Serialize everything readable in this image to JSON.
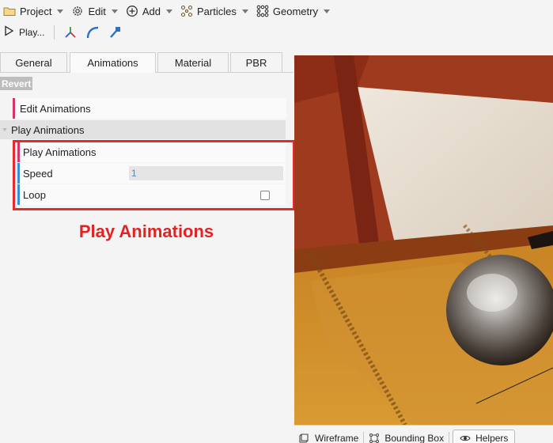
{
  "menubar": {
    "project": "Project",
    "edit": "Edit",
    "add": "Add",
    "particles": "Particles",
    "geometry": "Geometry"
  },
  "toolbar": {
    "play": "Play..."
  },
  "tabs": [
    "General",
    "Animations",
    "Material",
    "PBR"
  ],
  "panel": {
    "revert": "Revert",
    "edit_animations": "Edit Animations",
    "section_title": "Play Animations",
    "play_animations": "Play Animations",
    "speed_label": "Speed",
    "speed_value": "1",
    "loop_label": "Loop",
    "loop_checked": false
  },
  "annotation": "Play Animations",
  "viewport_toolbar": {
    "wireframe": "Wireframe",
    "bounding_box": "Bounding Box",
    "helpers": "Helpers"
  },
  "colors": {
    "highlight": "#e52b2b",
    "edit_accent": "#d7336b",
    "speed_accent": "#3b8dd6",
    "loop_accent": "#3b8dd6"
  }
}
